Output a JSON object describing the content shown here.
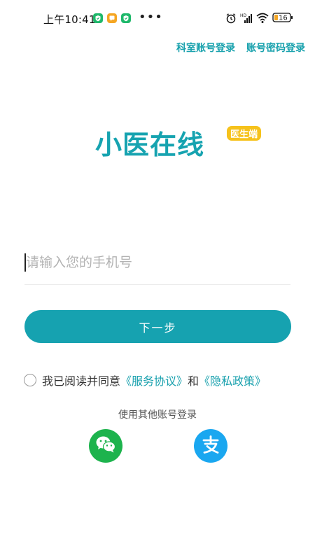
{
  "status_bar": {
    "time": "上午10:41",
    "dots": "•••",
    "battery": "16"
  },
  "header": {
    "dept_login": "科室账号登录",
    "password_login": "账号密码登录"
  },
  "logo": {
    "name": "小医在线",
    "badge": "医生端"
  },
  "login": {
    "phone_placeholder": "请输入您的手机号",
    "phone_value": "",
    "next_label": "下一步"
  },
  "agreement": {
    "prefix": "我已阅读并同意",
    "service_link": "《服务协议》",
    "conjunction": "和",
    "privacy_link": "《隐私政策》"
  },
  "other_login": {
    "title": "使用其他账号登录",
    "methods": [
      {
        "icon": "wechat-icon"
      },
      {
        "icon": "alipay-icon"
      }
    ]
  },
  "colors": {
    "accent": "#16a2b0",
    "badge": "#f6c21b",
    "wechat": "#1db34d",
    "alipay": "#1aa7f0"
  }
}
